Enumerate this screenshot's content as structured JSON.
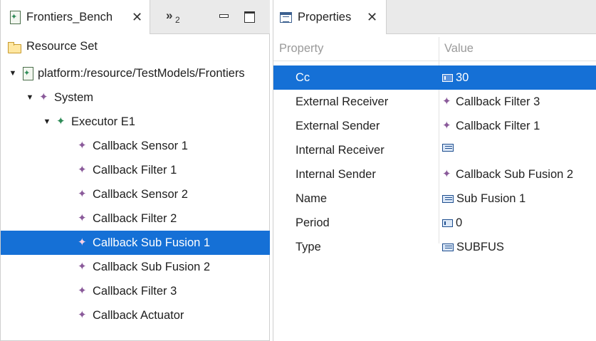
{
  "left_view": {
    "tab_title": "Frontiers_Bench",
    "tab_close": "✕",
    "overflow_chevron": "»",
    "overflow_count": "2",
    "resource_set_label": "Resource Set",
    "tree": [
      {
        "label": "platform:/resource/TestModels/Frontiers",
        "icon": "model-file-icon",
        "expanded": true
      },
      {
        "label": "System",
        "icon": "diamond-icon",
        "expanded": true
      },
      {
        "label": "Executor E1",
        "icon": "diamond-green-icon",
        "expanded": true
      },
      {
        "label": "Callback Sensor 1",
        "icon": "diamond-icon"
      },
      {
        "label": "Callback Filter 1",
        "icon": "diamond-icon"
      },
      {
        "label": "Callback Sensor 2",
        "icon": "diamond-icon"
      },
      {
        "label": "Callback Filter 2",
        "icon": "diamond-icon"
      },
      {
        "label": "Callback Sub Fusion 1",
        "icon": "diamond-pink-icon",
        "selected": true
      },
      {
        "label": "Callback Sub Fusion 2",
        "icon": "diamond-icon"
      },
      {
        "label": "Callback Filter 3",
        "icon": "diamond-icon"
      },
      {
        "label": "Callback Actuator",
        "icon": "diamond-icon"
      }
    ]
  },
  "properties_view": {
    "tab_title": "Properties",
    "tab_close": "✕",
    "col_property": "Property",
    "col_value": "Value",
    "rows": [
      {
        "name": "Cc",
        "value": "30",
        "icon": "number-icon",
        "selected": true
      },
      {
        "name": "External Receiver",
        "value": "Callback Filter 3",
        "icon": "diamond-icon"
      },
      {
        "name": "External Sender",
        "value": "Callback Filter 1",
        "icon": "diamond-icon"
      },
      {
        "name": "Internal Receiver",
        "value": "",
        "icon": "text-icon"
      },
      {
        "name": "Internal Sender",
        "value": "Callback Sub Fusion 2",
        "icon": "diamond-icon"
      },
      {
        "name": "Name",
        "value": "Sub Fusion 1",
        "icon": "text-icon"
      },
      {
        "name": "Period",
        "value": "0",
        "icon": "number-icon"
      },
      {
        "name": "Type",
        "value": "SUBFUS",
        "icon": "text-icon"
      }
    ]
  }
}
